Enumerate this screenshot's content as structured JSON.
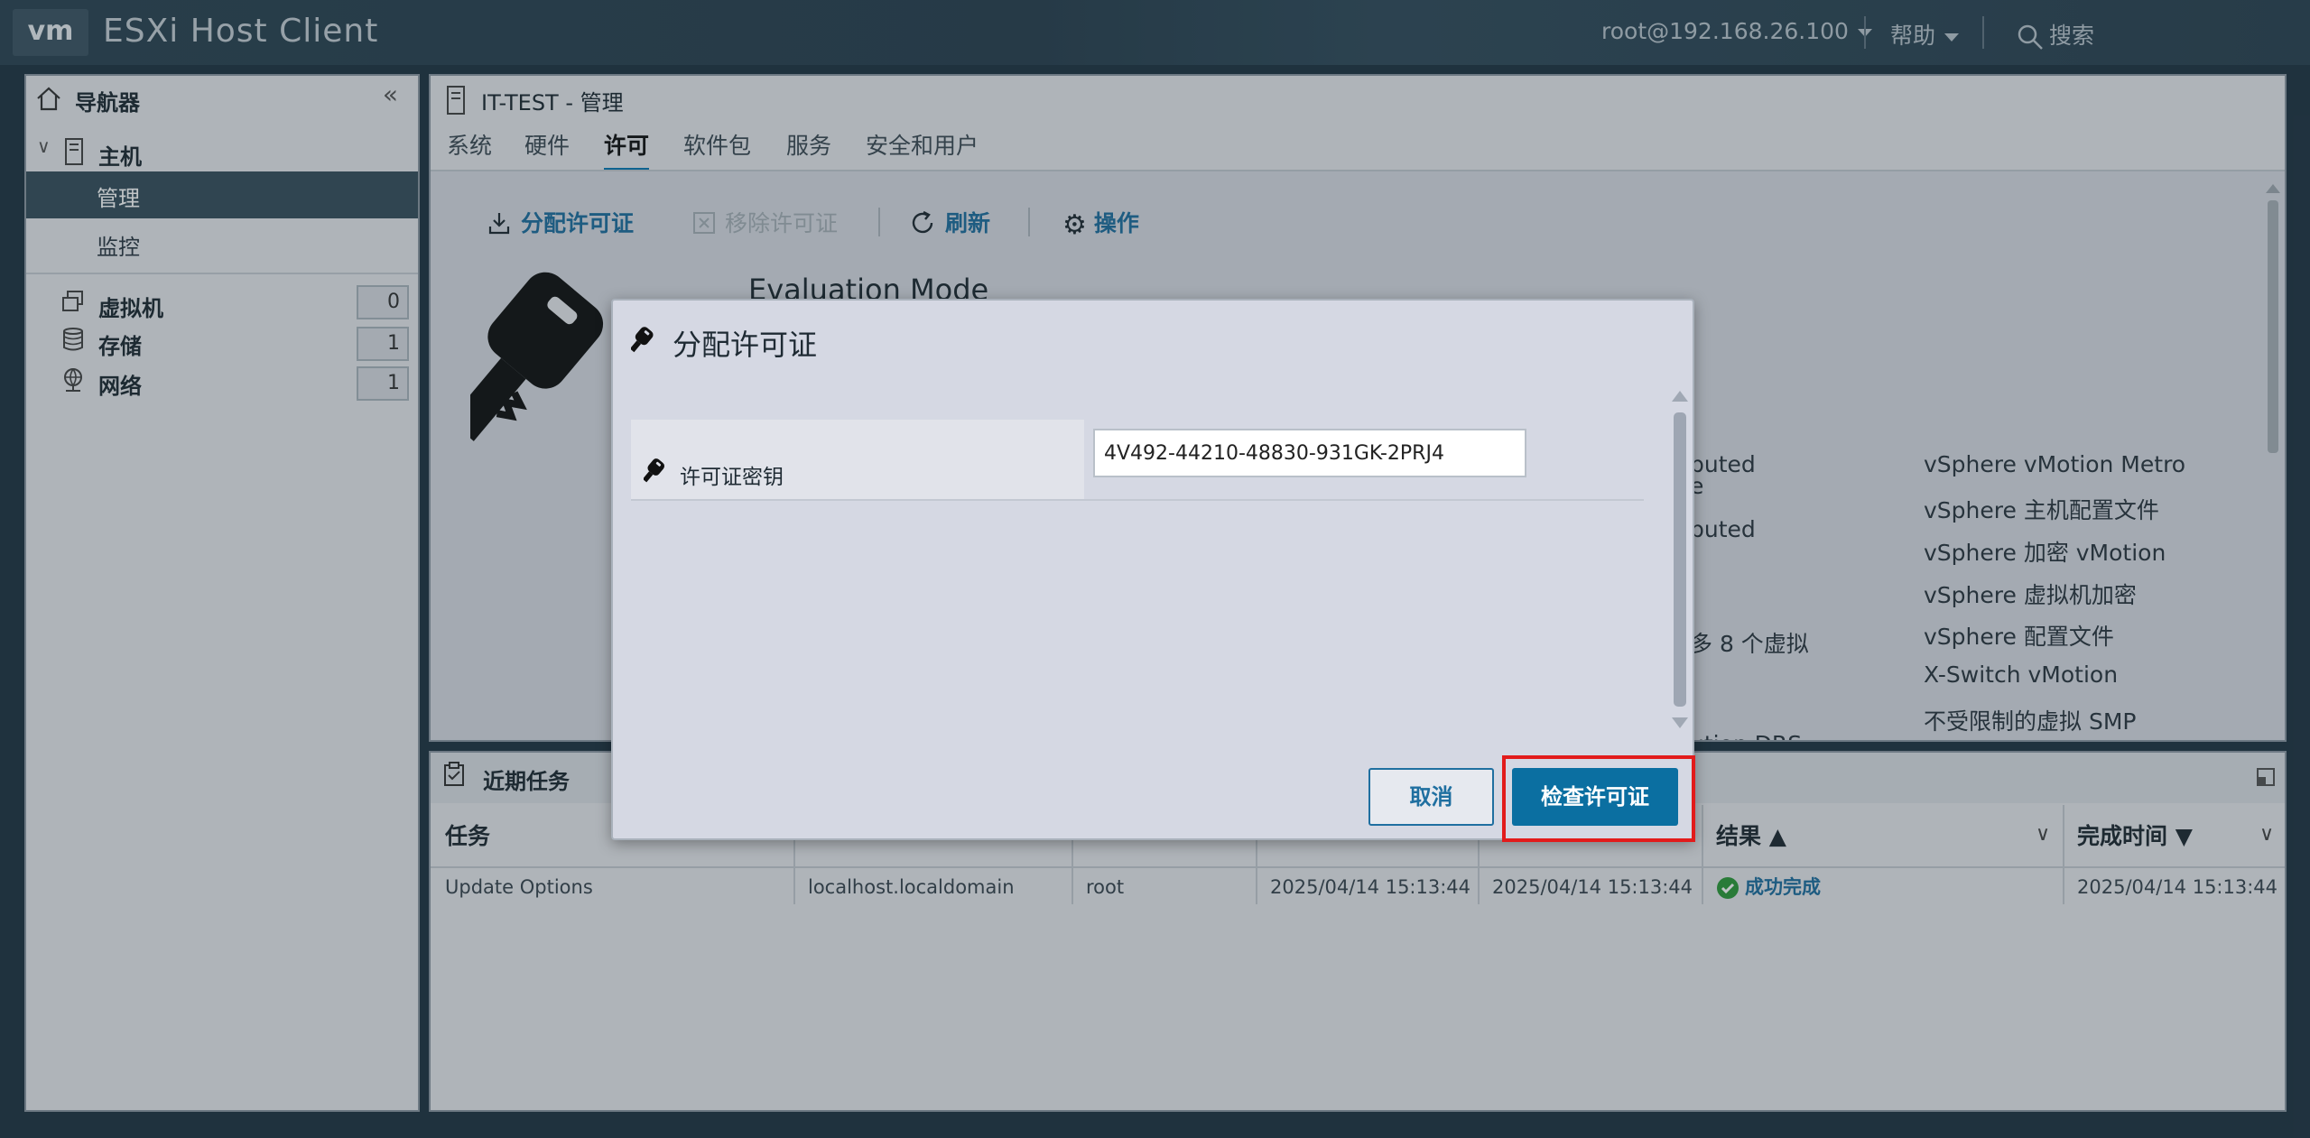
{
  "topbar": {
    "logo": "vm",
    "app_title": "ESXi Host Client",
    "user": "root@192.168.26.100",
    "help": "帮助",
    "search": "搜索"
  },
  "navigator": {
    "title": "导航器",
    "host_label": "主机",
    "host_items": [
      "管理",
      "监控"
    ],
    "selected": "管理",
    "sections": [
      {
        "label": "虚拟机",
        "count": "0"
      },
      {
        "label": "存储",
        "count": "1"
      },
      {
        "label": "网络",
        "count": "1"
      }
    ]
  },
  "main": {
    "title": "IT-TEST - 管理",
    "tabs": [
      "系统",
      "硬件",
      "许可",
      "软件包",
      "服务",
      "安全和用户"
    ],
    "active_tab": "许可",
    "actions": {
      "assign": "分配许可证",
      "remove": "移除许可证",
      "refresh": "刷新",
      "operations": "操作"
    },
    "license_mode": "Evaluation Mode",
    "features_partial": [
      "buted",
      "e",
      "buted",
      "多 8 个虚拟",
      "ution DRS"
    ],
    "features_right": [
      "vSphere vMotion Metro",
      "vSphere 主机配置文件",
      "vSphere 加密 vMotion",
      "vSphere 虚拟机加密",
      "vSphere 配置文件",
      "X-Switch vMotion",
      "不受限制的虚拟 SMP"
    ]
  },
  "tasks": {
    "title": "近期任务",
    "columns": {
      "task": "任务",
      "result": "结果 ▲",
      "completed": "完成时间 ▼"
    },
    "row": {
      "task": "Update Options",
      "target": "localhost.localdomain",
      "initiator": "root",
      "queued": "2025/04/14 15:13:44",
      "started": "2025/04/14 15:13:44",
      "result": "成功完成",
      "completed": "2025/04/14 15:13:44"
    }
  },
  "modal": {
    "title": "分配许可证",
    "field_label": "许可证密钥",
    "license_key": "4V492-44210-48830-931GK-2PRJ4",
    "cancel_label": "取消",
    "check_label": "检查许可证"
  },
  "colors": {
    "accent": "#0b6fa1",
    "highlight": "#e21b1b",
    "success": "#2e9a3b",
    "topbar": "#2d4554"
  }
}
